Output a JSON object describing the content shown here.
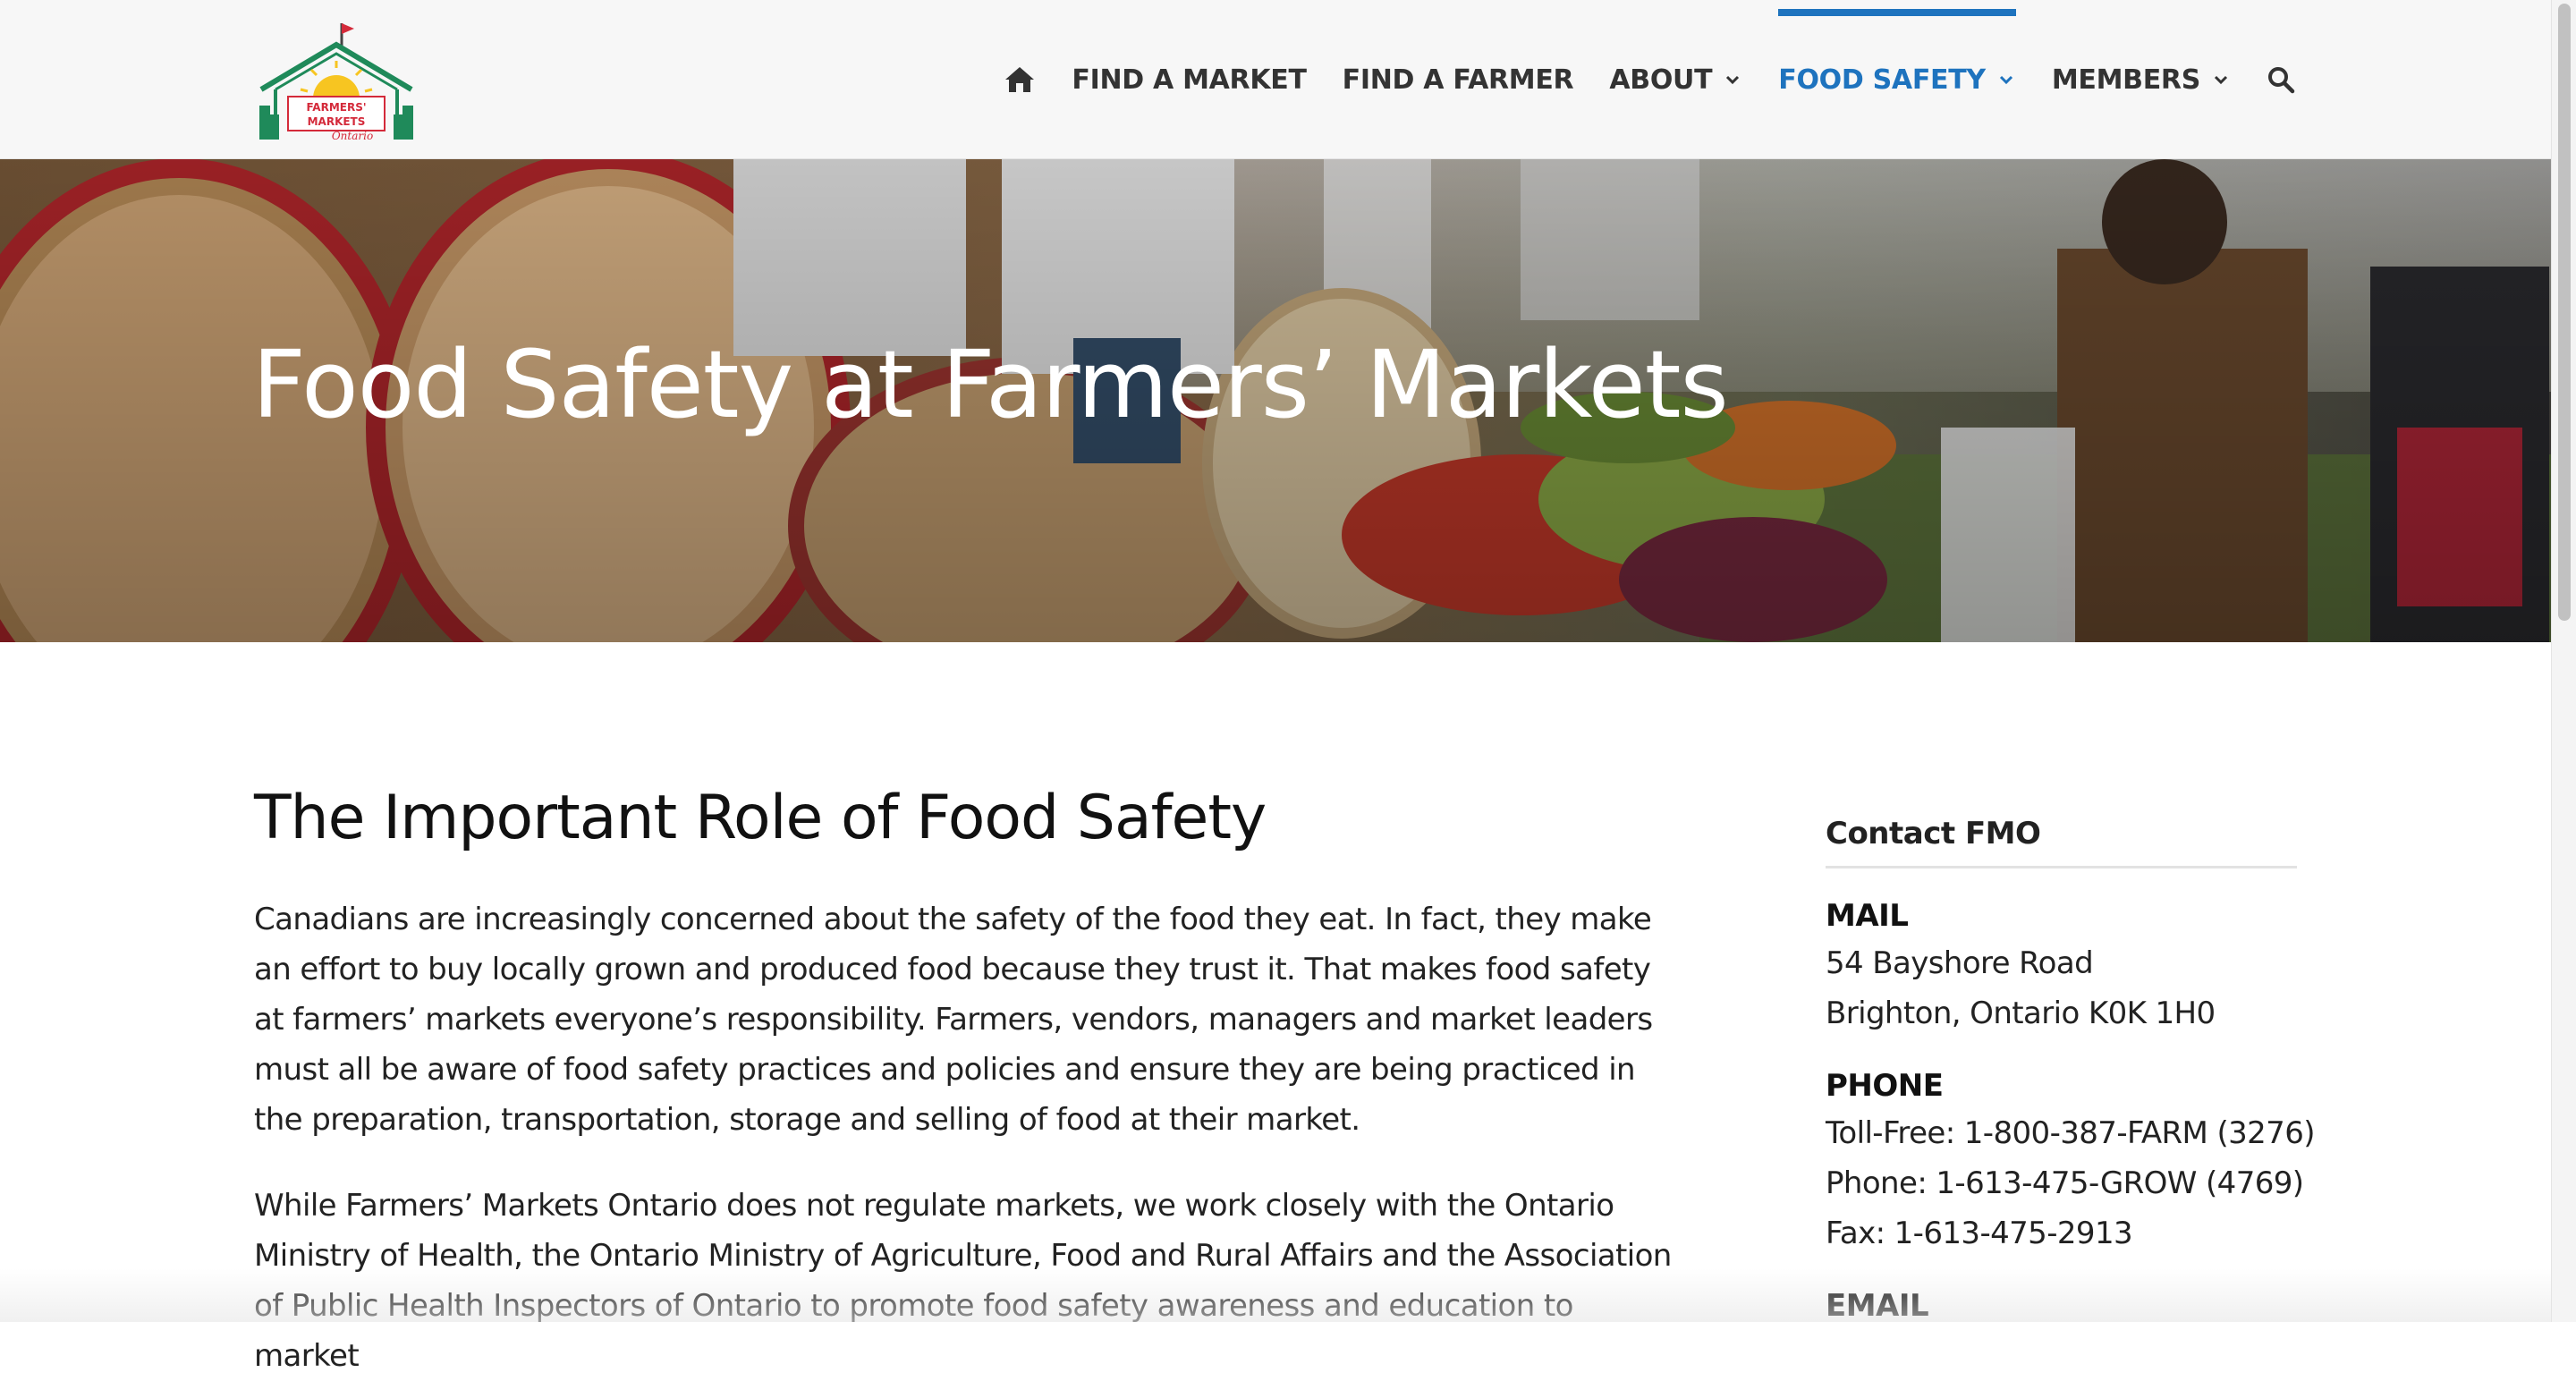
{
  "header": {
    "logo_text": [
      "FARMERS'",
      "MARKETS",
      "Ontario"
    ],
    "nav": {
      "home_icon": "home-icon",
      "find_market": "FIND A MARKET",
      "find_farmer": "FIND A FARMER",
      "about": "ABOUT",
      "food_safety": "FOOD SAFETY",
      "members": "MEMBERS",
      "search_icon": "search-icon",
      "active_item": "FOOD SAFETY"
    }
  },
  "hero": {
    "title": "Food Safety at Farmers’ Markets"
  },
  "main": {
    "title": "The Important Role of Food Safety",
    "paragraphs": [
      "Canadians are increasingly concerned about the safety of the food they eat. In fact, they make an effort to buy locally grown and produced food because they trust it. That makes food safety at farmers’ markets everyone’s responsibility. Farmers, vendors, managers and market leaders must all be aware of food safety practices and policies and ensure they are being practiced in the preparation, transportation, storage and selling of food at their market.",
      "While Farmers’ Markets Ontario does not regulate markets, we work closely with the Ontario Ministry of Health, the Ontario Ministry of Agriculture, Food and Rural Affairs and the Association of Public Health Inspectors of Ontario to promote food safety awareness and education to market"
    ]
  },
  "sidebar": {
    "title": "Contact FMO",
    "mail_label": "MAIL",
    "mail_lines": [
      "54 Bayshore Road",
      "Brighton, Ontario K0K 1H0"
    ],
    "phone_label": "PHONE",
    "phone_lines": [
      "Toll-Free: 1-800-387-FARM (3276)",
      "Phone: 1-613-475-GROW (4769)",
      "Fax: 1-613-475-2913"
    ],
    "email_label": "EMAIL"
  },
  "colors": {
    "accent": "#1e73be",
    "nav_text": "#333333",
    "header_bg": "#f7f7f7"
  }
}
